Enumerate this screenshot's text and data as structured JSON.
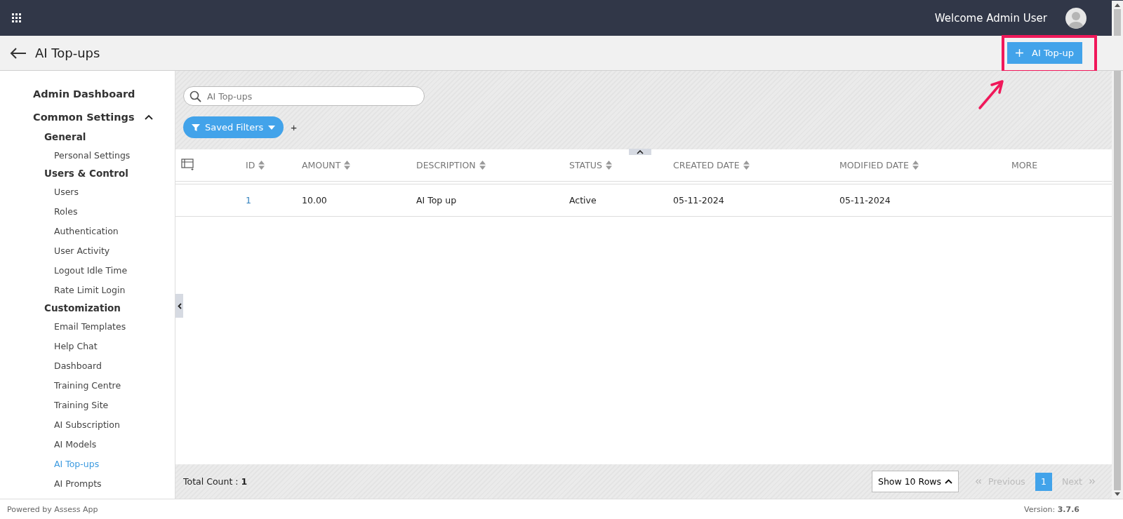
{
  "top_bar": {
    "welcome": "Welcome Admin User"
  },
  "header": {
    "title": "AI Top-ups",
    "add_button": "AI Top-up"
  },
  "sidebar": {
    "items": [
      {
        "label": "Admin Dashboard",
        "selected": false
      },
      {
        "label": "Common Settings",
        "expanded": true,
        "children": [
          {
            "label": "General",
            "children": [
              {
                "label": "Personal Settings",
                "selected": false
              }
            ]
          },
          {
            "label": "Users & Control",
            "children": [
              {
                "label": "Users",
                "selected": false
              },
              {
                "label": "Roles",
                "selected": false
              },
              {
                "label": "Authentication",
                "selected": false
              },
              {
                "label": "User Activity",
                "selected": false
              },
              {
                "label": "Logout Idle Time",
                "selected": false
              },
              {
                "label": "Rate Limit Login",
                "selected": false
              }
            ]
          },
          {
            "label": "Customization",
            "children": [
              {
                "label": "Email Templates",
                "selected": false
              },
              {
                "label": "Help Chat",
                "selected": false
              },
              {
                "label": "Dashboard",
                "selected": false
              },
              {
                "label": "Training Centre",
                "selected": false
              },
              {
                "label": "Training Site",
                "selected": false
              },
              {
                "label": "AI Subscription",
                "selected": false
              },
              {
                "label": "AI Models",
                "selected": false
              },
              {
                "label": "AI Top-ups",
                "selected": true
              },
              {
                "label": "AI Prompts",
                "selected": false
              }
            ]
          }
        ]
      }
    ]
  },
  "search": {
    "placeholder": "AI Top-ups"
  },
  "saved_filters": {
    "label": "Saved Filters",
    "add": "+"
  },
  "table": {
    "columns": [
      {
        "label": "ID",
        "sortable": true
      },
      {
        "label": "AMOUNT",
        "sortable": true
      },
      {
        "label": "DESCRIPTION",
        "sortable": true
      },
      {
        "label": "STATUS",
        "sortable": true
      },
      {
        "label": "CREATED DATE",
        "sortable": true
      },
      {
        "label": "MODIFIED DATE",
        "sortable": true
      },
      {
        "label": "MORE",
        "sortable": false
      }
    ],
    "rows": [
      {
        "cells": [
          "1",
          "10.00",
          "AI Top up",
          "Active",
          "05-11-2024",
          "05-11-2024",
          ""
        ]
      }
    ]
  },
  "table_footer": {
    "total_label": "Total Count : ",
    "total": "1",
    "rows_select": "Show 10 Rows",
    "pagination": [
      {
        "kind": "prev",
        "label": "Previous",
        "disabled": true
      },
      {
        "kind": "page",
        "label": "1",
        "selected": true
      },
      {
        "kind": "next",
        "label": "Next",
        "disabled": true
      }
    ]
  },
  "status_bar": {
    "powered": "Powered by Assess App",
    "version_label": "Version: ",
    "version": "3.7.6"
  }
}
